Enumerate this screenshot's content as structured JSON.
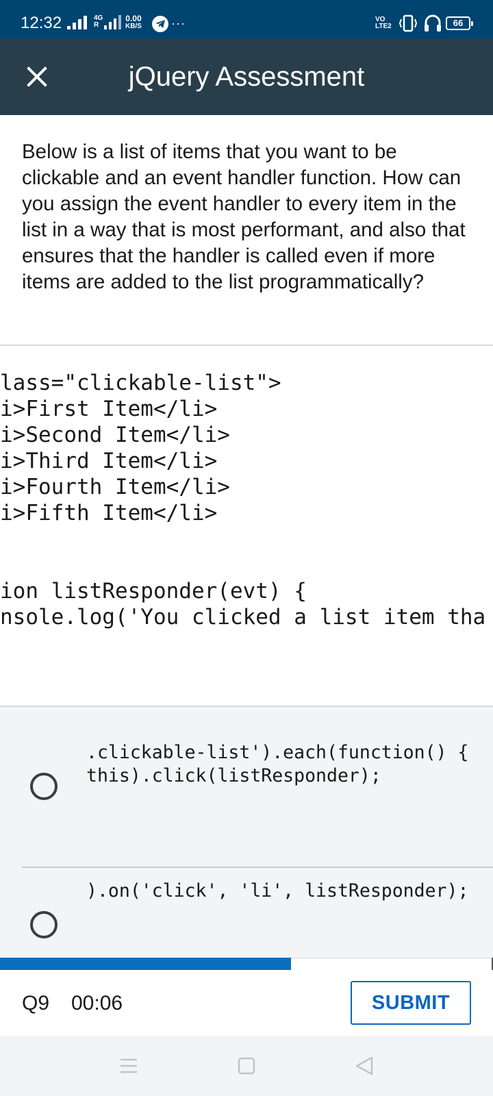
{
  "status_bar": {
    "time": "12:32",
    "network_type": "4G",
    "roaming": "R",
    "data_speed_value": "0.00",
    "data_speed_unit": "KB/S",
    "more": "···",
    "volte_top": "VO",
    "volte_bottom": "LTE2",
    "battery_level": "66"
  },
  "header": {
    "title": "jQuery Assessment",
    "close_icon": "close-icon"
  },
  "question": {
    "text": "Below is a list of items that you want to be clickable and an event handler function. How can you assign the event handler to every item in the list in a way that is most performant, and also that ensures that the handler is called even if more items are added to the list programmatically?"
  },
  "code": {
    "lines": [
      "lass=\"clickable-list\">",
      "i>First Item</li>",
      "i>Second Item</li>",
      "i>Third Item</li>",
      "i>Fourth Item</li>",
      "i>Fifth Item</li>",
      "ion listResponder(evt) {",
      "nsole.log('You clicked a list item tha"
    ]
  },
  "options": [
    {
      "lines": [
        ".clickable-list').each(function() {",
        "this).click(listResponder);"
      ]
    },
    {
      "lines": [
        ").on('click', 'li', listResponder);"
      ]
    }
  ],
  "progress": {
    "fraction": 0.59
  },
  "footer": {
    "question_number": "Q9",
    "timer": "00:06",
    "submit_label": "SUBMIT"
  },
  "colors": {
    "status_bar": "#004471",
    "header": "#283e4a",
    "accent": "#0a66c2",
    "progress": "#0a6ebd"
  }
}
